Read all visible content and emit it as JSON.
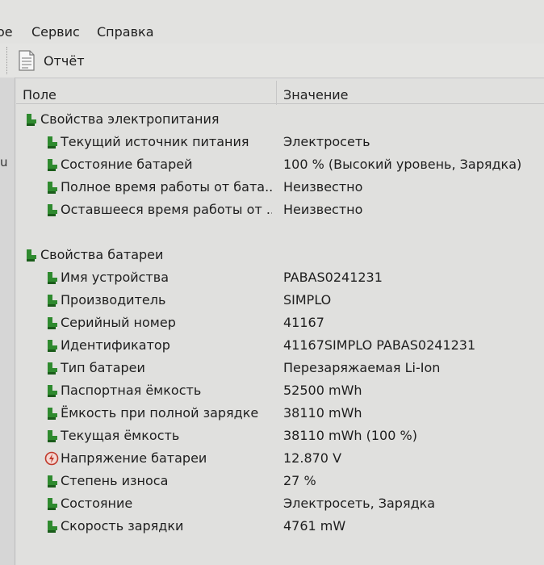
{
  "menu": {
    "item1": "ое",
    "item2": "Сервис",
    "item3": "Справка"
  },
  "toolbar": {
    "report_label": "Отчёт"
  },
  "left_pane": {
    "stub": "u"
  },
  "columns": {
    "field": "Поле",
    "value": "Значение"
  },
  "sections": [
    {
      "title": "Свойства электропитания",
      "rows": [
        {
          "field": "Текущий источник питания",
          "value": "Электросеть",
          "icon": "battery-icon"
        },
        {
          "field": "Состояние батарей",
          "value": "100 % (Высокий уровень, Зарядка)",
          "icon": "battery-icon"
        },
        {
          "field": "Полное время работы от бата...",
          "value": "Неизвестно",
          "icon": "battery-icon"
        },
        {
          "field": "Оставшееся время работы от ...",
          "value": "Неизвестно",
          "icon": "battery-icon"
        }
      ]
    },
    {
      "title": "Свойства батареи",
      "rows": [
        {
          "field": "Имя устройства",
          "value": "PABAS0241231",
          "icon": "battery-icon"
        },
        {
          "field": "Производитель",
          "value": "SIMPLO",
          "icon": "battery-icon"
        },
        {
          "field": "Серийный номер",
          "value": "41167",
          "icon": "battery-icon"
        },
        {
          "field": "Идентификатор",
          "value": "41167SIMPLO PABAS0241231",
          "icon": "battery-icon"
        },
        {
          "field": "Тип батареи",
          "value": "Перезаряжаемая Li-Ion",
          "icon": "battery-icon"
        },
        {
          "field": "Паспортная ёмкость",
          "value": "52500 mWh",
          "icon": "battery-icon"
        },
        {
          "field": "Ёмкость при полной зарядке",
          "value": "38110 mWh",
          "icon": "battery-icon"
        },
        {
          "field": "Текущая ёмкость",
          "value": "38110 mWh  (100 %)",
          "icon": "battery-icon"
        },
        {
          "field": "Напряжение батареи",
          "value": "12.870 V",
          "icon": "voltage-icon"
        },
        {
          "field": "Степень износа",
          "value": "27 %",
          "icon": "battery-icon"
        },
        {
          "field": "Состояние",
          "value": "Электросеть, Зарядка",
          "icon": "battery-icon"
        },
        {
          "field": "Скорость зарядки",
          "value": "4761 mW",
          "icon": "battery-icon"
        }
      ]
    }
  ],
  "colors": {
    "battery_green": "#2f8a2f",
    "voltage_red": "#c0392b"
  }
}
